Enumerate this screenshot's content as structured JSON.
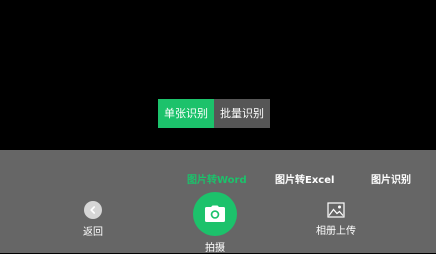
{
  "mode_toggle": {
    "single_label": "单张识别",
    "batch_label": "批量识别",
    "selected": "single"
  },
  "tabs": [
    {
      "label": "图片转Word",
      "active": true
    },
    {
      "label": "图片转Excel",
      "active": false
    },
    {
      "label": "图片识别",
      "active": false
    }
  ],
  "actions": {
    "back_label": "返回",
    "shutter_label": "拍摄",
    "album_label": "相册上传"
  },
  "icons": {
    "back": "chevron-left-icon",
    "shutter": "camera-icon",
    "album": "image-icon"
  },
  "colors": {
    "accent": "#1cc26b",
    "panel": "#666666",
    "batch_bg": "#565656",
    "viewfinder": "#000000"
  }
}
